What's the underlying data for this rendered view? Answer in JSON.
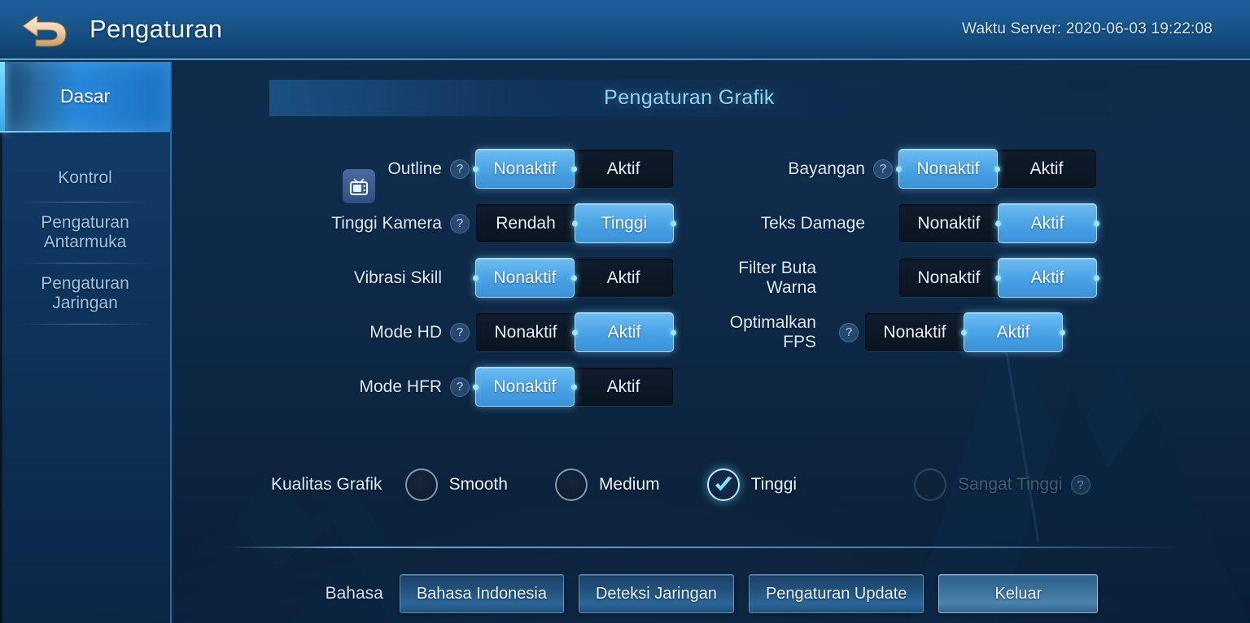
{
  "header": {
    "back_icon": "back-arrow-icon",
    "title": "Pengaturan",
    "server_time": "Waktu Server: 2020-06-03 19:22:08"
  },
  "sidebar": {
    "items": [
      {
        "label": "Dasar",
        "active": true
      },
      {
        "label": "Kontrol",
        "active": false
      },
      {
        "label": "Pengaturan Antarmuka",
        "active": false
      },
      {
        "label": "Pengaturan Jaringan",
        "active": false
      }
    ]
  },
  "panel": {
    "title": "Pengaturan Grafik",
    "badge_icon": "tv-icon"
  },
  "settings": {
    "left_column": [
      {
        "label": "Outline",
        "help": "?",
        "options": [
          "Nonaktif",
          "Aktif"
        ],
        "selected": 0
      },
      {
        "label": "Tinggi Kamera",
        "help": "?",
        "options": [
          "Rendah",
          "Tinggi"
        ],
        "selected": 1
      },
      {
        "label": "Vibrasi Skill",
        "help": "",
        "options": [
          "Nonaktif",
          "Aktif"
        ],
        "selected": 0
      },
      {
        "label": "Mode HD",
        "help": "?",
        "options": [
          "Nonaktif",
          "Aktif"
        ],
        "selected": 1
      },
      {
        "label": "Mode HFR",
        "help": "?",
        "options": [
          "Nonaktif",
          "Aktif"
        ],
        "selected": 0
      }
    ],
    "right_column": [
      {
        "label": "Bayangan",
        "help": "?",
        "options": [
          "Nonaktif",
          "Aktif"
        ],
        "selected": 0
      },
      {
        "label": "Teks Damage",
        "help": "",
        "options": [
          "Nonaktif",
          "Aktif"
        ],
        "selected": 1
      },
      {
        "label": "Filter Buta Warna",
        "help": "",
        "options": [
          "Nonaktif",
          "Aktif"
        ],
        "selected": 1
      },
      {
        "label": "Optimalkan FPS",
        "help": "?",
        "options": [
          "Nonaktif",
          "Aktif"
        ],
        "selected": 1
      }
    ]
  },
  "quality": {
    "label": "Kualitas Grafik",
    "options": [
      {
        "label": "Smooth",
        "checked": false,
        "disabled": false,
        "help": ""
      },
      {
        "label": "Medium",
        "checked": false,
        "disabled": false,
        "help": ""
      },
      {
        "label": "Tinggi",
        "checked": true,
        "disabled": false,
        "help": ""
      },
      {
        "label": "Sangat Tinggi",
        "checked": false,
        "disabled": true,
        "help": "?"
      }
    ]
  },
  "bottom": {
    "bahasa_label": "Bahasa",
    "language_button": "Bahasa Indonesia",
    "network_button": "Deteksi Jaringan",
    "update_button": "Pengaturan Update",
    "exit_button": "Keluar"
  },
  "colors": {
    "accent_blue": "#4ba4e6",
    "accent_cyan": "#8fd6f5",
    "track_dark": "#101d2e",
    "header_blue": "#1a5890",
    "back_arrow_gold": "#e8c9a0"
  }
}
